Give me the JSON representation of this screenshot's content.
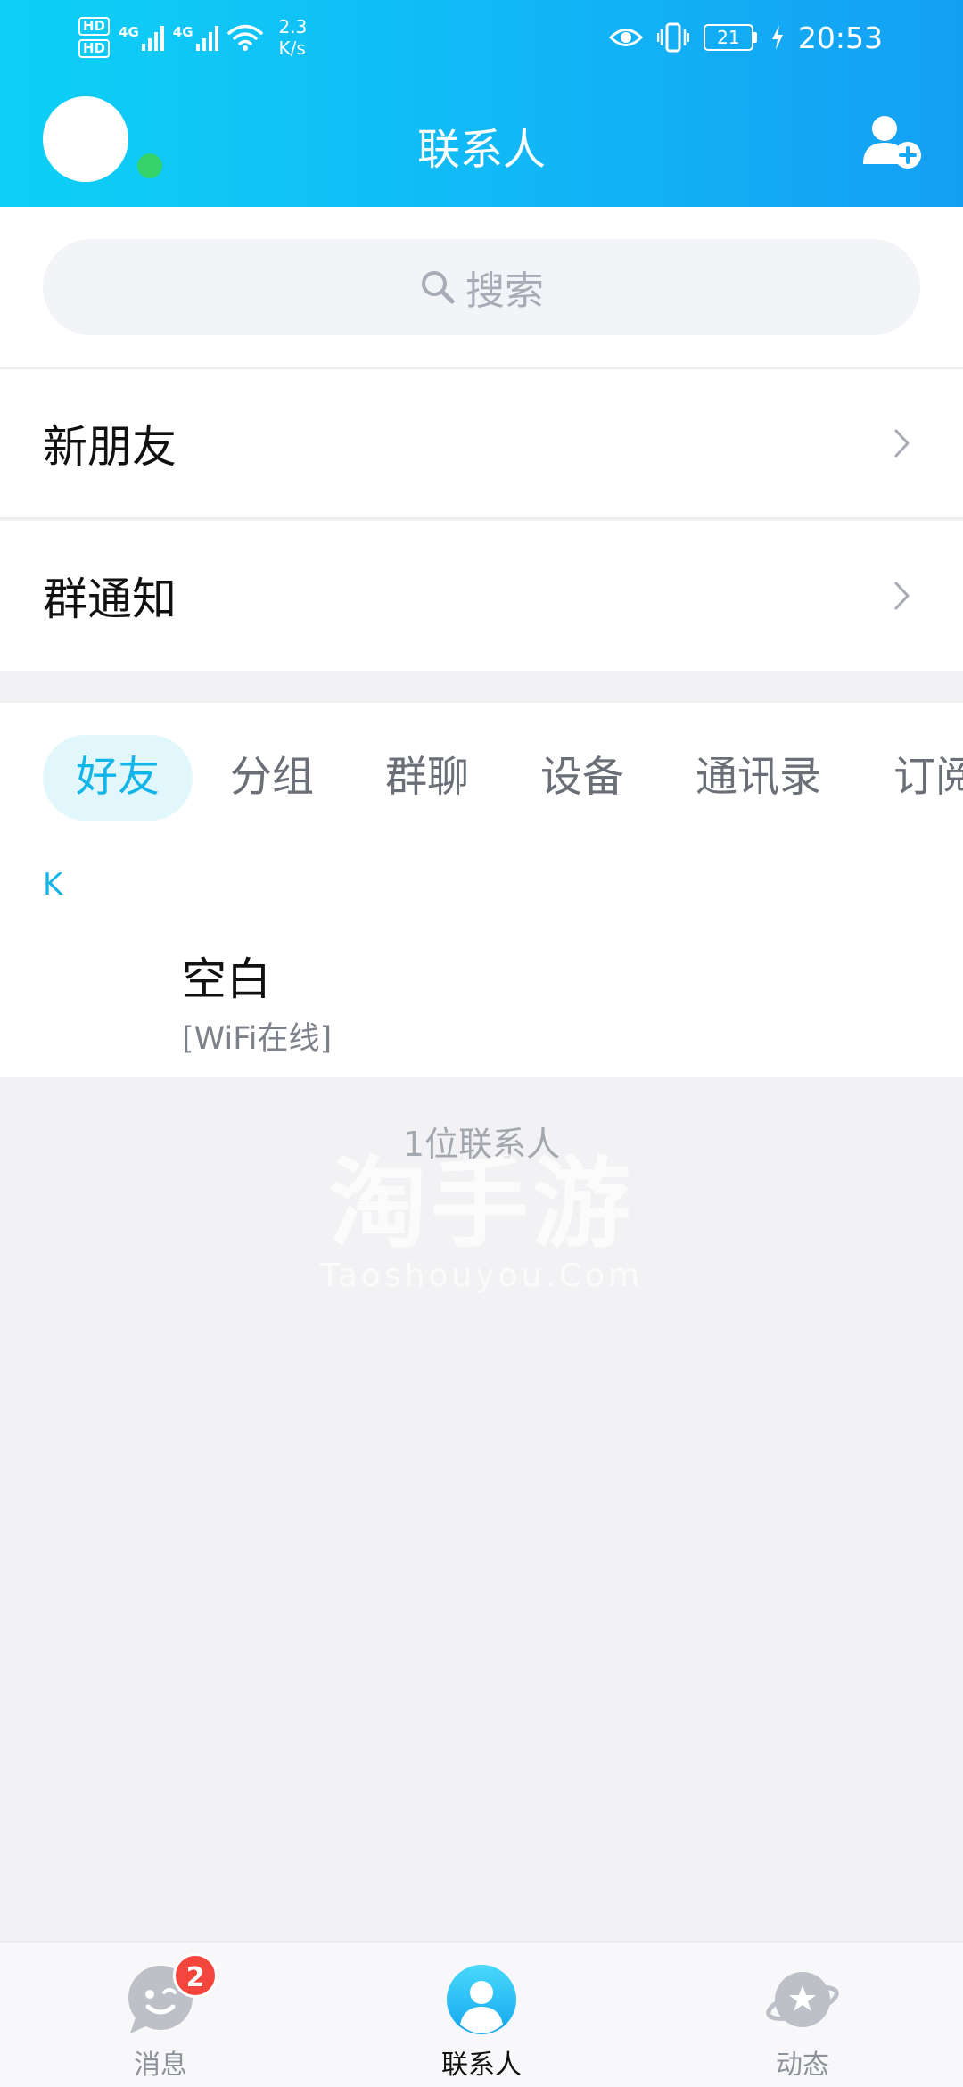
{
  "status_bar": {
    "hd1": "HD",
    "hd2": "HD",
    "net1": "4G",
    "net2": "4G",
    "speed_value": "2.3",
    "speed_unit": "K/s",
    "battery": "21",
    "time": "20:53"
  },
  "header": {
    "title": "联系人"
  },
  "search": {
    "placeholder": "搜索"
  },
  "menu": {
    "new_friends": "新朋友",
    "group_notice": "群通知"
  },
  "tabs": [
    {
      "label": "好友",
      "active": true
    },
    {
      "label": "分组"
    },
    {
      "label": "群聊"
    },
    {
      "label": "设备"
    },
    {
      "label": "通讯录"
    },
    {
      "label": "订阅"
    }
  ],
  "contacts": {
    "section_letter": "K",
    "items": [
      {
        "name": "空白",
        "status": "[WiFi在线]"
      }
    ],
    "count_text": "1位联系人"
  },
  "watermark": {
    "main": "淘手游",
    "sub": "Taoshouyou.Com"
  },
  "bottom_nav": {
    "items": [
      {
        "label": "消息",
        "icon": "message-icon",
        "badge": "2"
      },
      {
        "label": "联系人",
        "icon": "contacts-icon",
        "active": true
      },
      {
        "label": "动态",
        "icon": "planet-icon"
      }
    ]
  },
  "colors": {
    "accent": "#12b5e8",
    "header_start": "#0ed0f6",
    "header_end": "#149ff3",
    "online": "#35d36a",
    "badge": "#f5463d"
  }
}
